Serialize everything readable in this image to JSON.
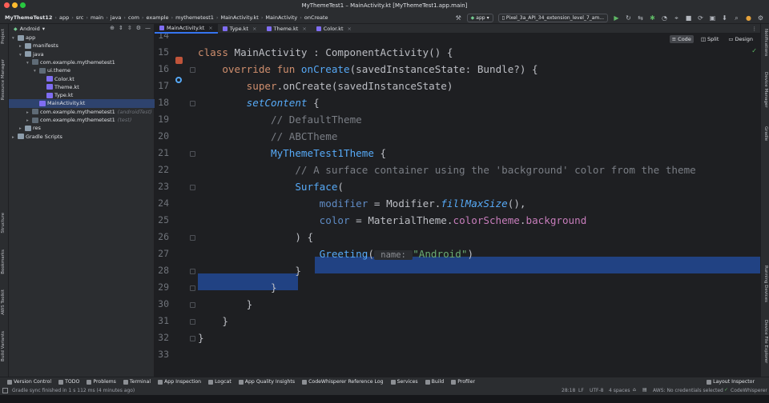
{
  "window": {
    "title": "MyThemeTest1 – MainActivity.kt [MyThemeTest1.app.main]"
  },
  "breadcrumbs": [
    "MyThemeTest12",
    "app",
    "src",
    "main",
    "java",
    "com",
    "example",
    "mythemetest1",
    "MainActivity.kt",
    "MainActivity",
    "onCreate"
  ],
  "run_config": "app",
  "device": "Pixel_3a_API_34_extension_level_7_am...",
  "project_panel": {
    "view": "Android",
    "tree": [
      {
        "label": "app",
        "depth": 0,
        "kind": "folder",
        "arrow": "▾"
      },
      {
        "label": "manifests",
        "depth": 1,
        "kind": "folder",
        "arrow": "▸"
      },
      {
        "label": "java",
        "depth": 1,
        "kind": "folder",
        "arrow": "▾"
      },
      {
        "label": "com.example.mythemetest1",
        "depth": 2,
        "kind": "pkg",
        "arrow": "▾"
      },
      {
        "label": "ui.theme",
        "depth": 3,
        "kind": "pkg",
        "arrow": "▾"
      },
      {
        "label": "Color.kt",
        "depth": 4,
        "kind": "kt",
        "arrow": ""
      },
      {
        "label": "Theme.kt",
        "depth": 4,
        "kind": "kt",
        "arrow": ""
      },
      {
        "label": "Type.kt",
        "depth": 4,
        "kind": "kt",
        "arrow": ""
      },
      {
        "label": "MainActivity.kt",
        "depth": 3,
        "kind": "kt",
        "arrow": "",
        "selected": true
      },
      {
        "label": "com.example.mythemetest1",
        "hint": "(androidTest)",
        "depth": 2,
        "kind": "pkg",
        "arrow": "▸"
      },
      {
        "label": "com.example.mythemetest1",
        "hint": "(test)",
        "depth": 2,
        "kind": "pkg",
        "arrow": "▸"
      },
      {
        "label": "res",
        "depth": 1,
        "kind": "folder",
        "arrow": "▸"
      },
      {
        "label": "Gradle Scripts",
        "depth": 0,
        "kind": "folder",
        "arrow": "▸"
      }
    ]
  },
  "tabs": [
    {
      "label": "MainActivity.kt",
      "active": true
    },
    {
      "label": "Type.kt",
      "active": false
    },
    {
      "label": "Theme.kt",
      "active": false
    },
    {
      "label": "Color.kt",
      "active": false
    }
  ],
  "view_modes": [
    "Code",
    "Split",
    "Design"
  ],
  "editor": {
    "lines": [
      {
        "n": "14",
        "tokens": []
      },
      {
        "n": "15",
        "tokens": [
          [
            "kw",
            "class "
          ],
          [
            "cls",
            "MainActivity : ComponentActivity() {"
          ]
        ]
      },
      {
        "n": "16",
        "tokens": [
          [
            "",
            "    "
          ],
          [
            "kw",
            "override fun "
          ],
          [
            "fn",
            "onCreate"
          ],
          [
            "",
            "(savedInstanceState: Bundle?) {"
          ]
        ]
      },
      {
        "n": "17",
        "tokens": [
          [
            "",
            "        "
          ],
          [
            "kw",
            "super"
          ],
          [
            "",
            ".onCreate(savedInstanceState)"
          ]
        ]
      },
      {
        "n": "18",
        "tokens": [
          [
            "",
            "        "
          ],
          [
            "fnc ital",
            "setContent"
          ],
          [
            "",
            " {"
          ]
        ]
      },
      {
        "n": "19",
        "tokens": [
          [
            "",
            "            "
          ],
          [
            "cm",
            "// DefaultTheme"
          ]
        ]
      },
      {
        "n": "20",
        "tokens": [
          [
            "",
            "            "
          ],
          [
            "cm",
            "// ABCTheme"
          ]
        ]
      },
      {
        "n": "21",
        "tokens": [
          [
            "",
            "            "
          ],
          [
            "comp",
            "MyThemeTest1Theme"
          ],
          [
            "",
            " {"
          ]
        ]
      },
      {
        "n": "22",
        "tokens": [
          [
            "",
            "                "
          ],
          [
            "cm",
            "// A surface container using the 'background' color from the theme"
          ]
        ]
      },
      {
        "n": "23",
        "tokens": [
          [
            "",
            "                "
          ],
          [
            "comp",
            "Surface"
          ],
          [
            "",
            "("
          ]
        ]
      },
      {
        "n": "24",
        "tokens": [
          [
            "",
            "                    "
          ],
          [
            "param",
            "modifier"
          ],
          [
            "",
            " = Modifier."
          ],
          [
            "fnc ital",
            "fillMaxSize"
          ],
          [
            "",
            "(),"
          ]
        ]
      },
      {
        "n": "25",
        "tokens": [
          [
            "",
            "                    "
          ],
          [
            "param",
            "color"
          ],
          [
            "",
            " = MaterialTheme."
          ],
          [
            "prop",
            "colorScheme"
          ],
          [
            "",
            "."
          ],
          [
            "prop",
            "background"
          ]
        ]
      },
      {
        "n": "26",
        "tokens": [
          [
            "",
            "                ) {"
          ]
        ]
      },
      {
        "n": "27",
        "tokens": [
          [
            "",
            "                    "
          ],
          [
            "comp",
            "Greeting"
          ],
          [
            "",
            "("
          ],
          [
            "hint",
            " name: "
          ],
          [
            "str",
            "\"Android\""
          ],
          [
            "",
            ")"
          ]
        ]
      },
      {
        "n": "28",
        "tokens": [
          [
            "",
            "                }"
          ]
        ]
      },
      {
        "n": "29",
        "tokens": [
          [
            "",
            "            }"
          ]
        ]
      },
      {
        "n": "30",
        "tokens": [
          [
            "",
            "        }"
          ]
        ]
      },
      {
        "n": "31",
        "tokens": [
          [
            "",
            "    }"
          ]
        ]
      },
      {
        "n": "32",
        "tokens": [
          [
            "",
            "}"
          ]
        ]
      },
      {
        "n": "33",
        "tokens": []
      }
    ]
  },
  "left_stripe": [
    "Project",
    "Resource Manager",
    "Structure",
    "Bookmarks",
    "AWS Toolkit",
    "Build Variants"
  ],
  "right_stripe": [
    "Notifications",
    "Device Manager",
    "Gradle",
    "Running Devices",
    "Device File Explorer"
  ],
  "tool_windows": [
    "Version Control",
    "TODO",
    "Problems",
    "Terminal",
    "App Inspection",
    "Logcat",
    "App Quality Insights",
    "CodeWhisperer Reference Log",
    "Services",
    "Build",
    "Profiler"
  ],
  "layout_inspector": "Layout Inspector",
  "status": {
    "message": "Gradle sync finished in 1 s 112 ms (4 minutes ago)",
    "position": "28:18",
    "line_sep": "LF",
    "encoding": "UTF-8",
    "indent": "4 spaces",
    "aws": "AWS: No credentials selected",
    "codewhisperer": "CodeWhisperer"
  },
  "colors": {
    "selection": "#214283",
    "accent": "#3574f0",
    "editor_bg": "#1e1f22",
    "panel_bg": "#2b2d30"
  }
}
